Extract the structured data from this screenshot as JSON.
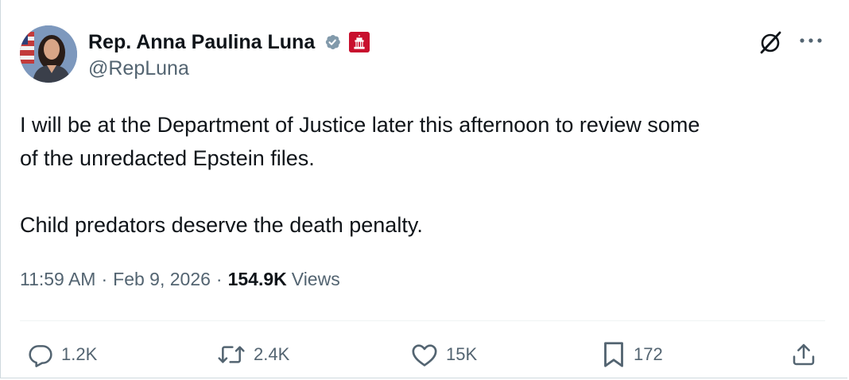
{
  "author": {
    "display_name": "Rep. Anna Paulina Luna",
    "handle": "@RepLuna",
    "avatar_icon": "profile-photo"
  },
  "post": {
    "text_line_1": "I will be at the Department of Justice later this afternoon to review some",
    "text_line_2": "of the unredacted Epstein files.",
    "text_line_3": "Child predators deserve the death penalty."
  },
  "meta": {
    "time": "11:59 AM",
    "separator": "·",
    "date": "Feb 9, 2026",
    "views_count": "154.9K",
    "views_label": "Views"
  },
  "actions": {
    "replies": "1.2K",
    "reposts": "2.4K",
    "likes": "15K",
    "bookmarks": "172"
  },
  "colors": {
    "primary_text": "#0f1419",
    "secondary_text": "#536471",
    "verified_badge": "#829aab",
    "affiliation_badge": "#c8102e"
  }
}
